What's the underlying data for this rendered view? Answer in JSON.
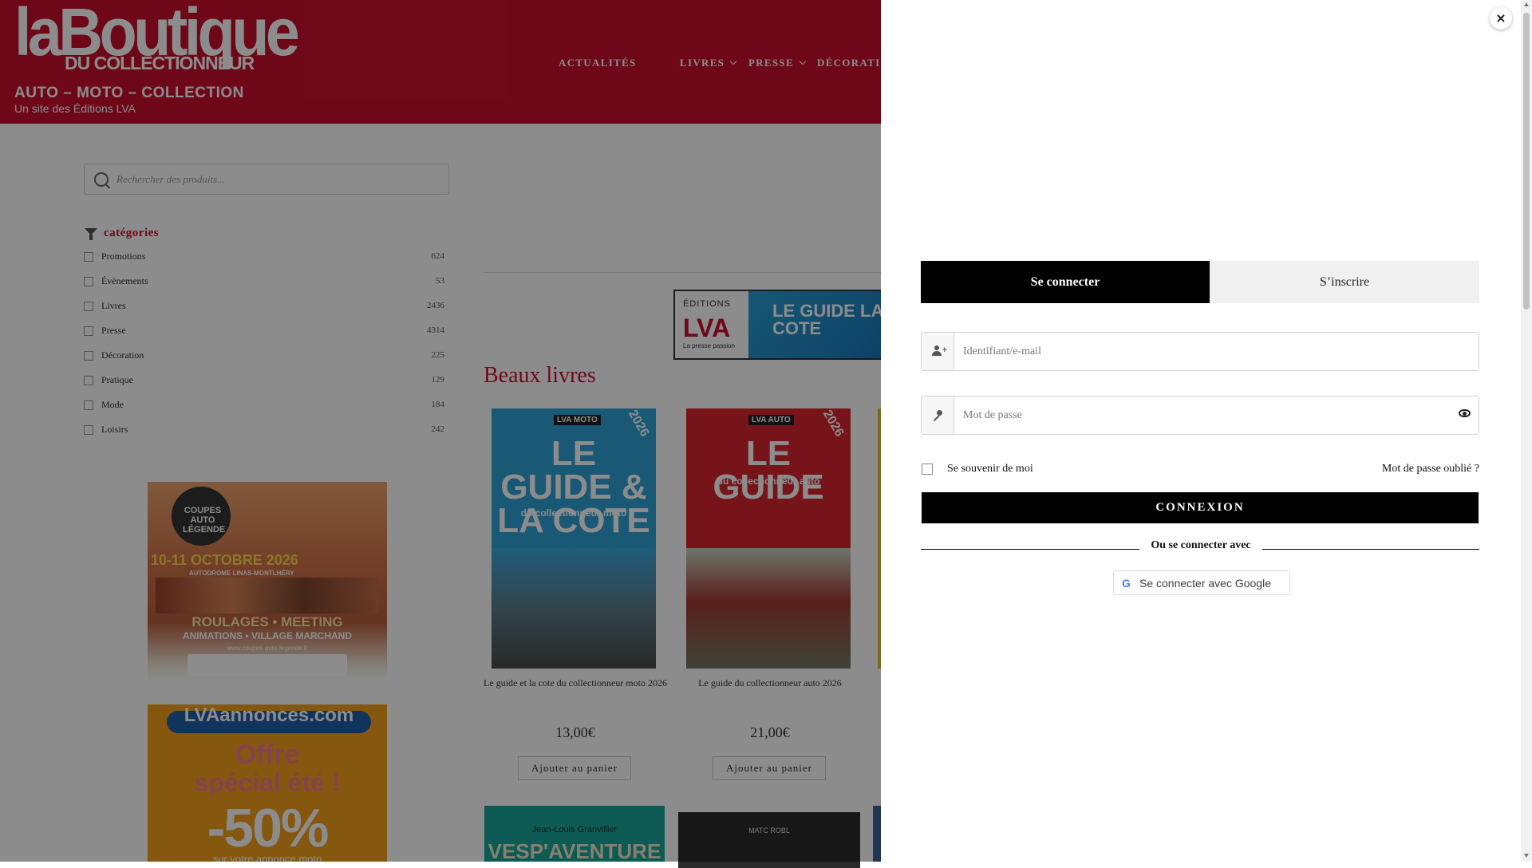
{
  "header": {
    "logo_main": "laBoutique",
    "logo_sub": "DU COLLECTIONNEUR",
    "tagline": "AUTO – MOTO – COLLECTION",
    "subtagline": "Un site des Éditions LVA",
    "nav": [
      {
        "label": "ACTUALITÉS"
      },
      {
        "label": "LIVRES"
      },
      {
        "label": "PRESSE"
      },
      {
        "label": "DÉCORATIO"
      }
    ]
  },
  "sidebar": {
    "search_placeholder": "Rechercher des produits...",
    "categories_title": "catégories",
    "categories": [
      {
        "name": "Promotions",
        "count": "624"
      },
      {
        "name": "Évènements",
        "count": "53"
      },
      {
        "name": "Livres",
        "count": "2436"
      },
      {
        "name": "Presse",
        "count": "4314"
      },
      {
        "name": "Décoration",
        "count": "225"
      },
      {
        "name": "Pratique",
        "count": "129"
      },
      {
        "name": "Mode",
        "count": "184"
      },
      {
        "name": "Loisirs",
        "count": "242"
      }
    ],
    "banner1": {
      "ring_text": "COUPES AUTO LÉGENDE",
      "date": "10-11 OCTOBRE 2026",
      "place": "AUTODROME LINAS-MONTLHÉRY",
      "line1": "ROULAGES • MEETING",
      "line2": "ANIMATIONS • VILLAGE MARCHAND",
      "url": "www.coupes-auto-legende.fr"
    },
    "banner2": {
      "head": "LVAannonces.com",
      "line1": "Offre",
      "line2": "spécial été !",
      "line3": "-50%",
      "line4": "sur votre annonce moto"
    }
  },
  "main": {
    "top_banner": {
      "editions": "ÉDITIONS",
      "lva": "LVA",
      "tagline": "La presse passion",
      "guide": "LE GUIDE LA COTE"
    },
    "section_title": "Beaux livres",
    "products": [
      {
        "brand": "LVA MOTO",
        "year": "2026",
        "cover_big": "LE GUIDE & LA COTE",
        "cover_sub": "du collectionneur moto",
        "name": "Le guide et la cote du collectionneur moto 2026",
        "price": "13,00€",
        "button": "Ajouter au panier",
        "color": "#2ea3d8"
      },
      {
        "brand": "LVA AUTO",
        "year": "2026",
        "cover_big": "LE GUIDE",
        "cover_sub": "du collectionneur auto",
        "name": "Le guide du collectionneur auto 2026",
        "price": "21,00€",
        "button": "Ajouter au panier",
        "color": "#d8262f"
      }
    ],
    "strip": [
      {
        "author": "Jean-Louis Granvillier",
        "title": "VESP'AVENTURE"
      },
      {
        "author": "MATC ROBL",
        "title": ""
      }
    ]
  },
  "login": {
    "tab_login": "Se connecter",
    "tab_register": "S’inscrire",
    "username_placeholder": "Identifiant/e-mail",
    "password_placeholder": "Mot de passe",
    "remember": "Se souvenir de moi",
    "forgot": "Mot de passe oublié ?",
    "submit": "CONNEXION",
    "or": "Ou se connecter avec",
    "google_label": "Se connecter avec Google",
    "google_glyph": "G",
    "close": "×"
  },
  "colors": {
    "brand_red": "#c8102e",
    "black": "#000000",
    "tab_inactive": "#f0f0f0"
  }
}
